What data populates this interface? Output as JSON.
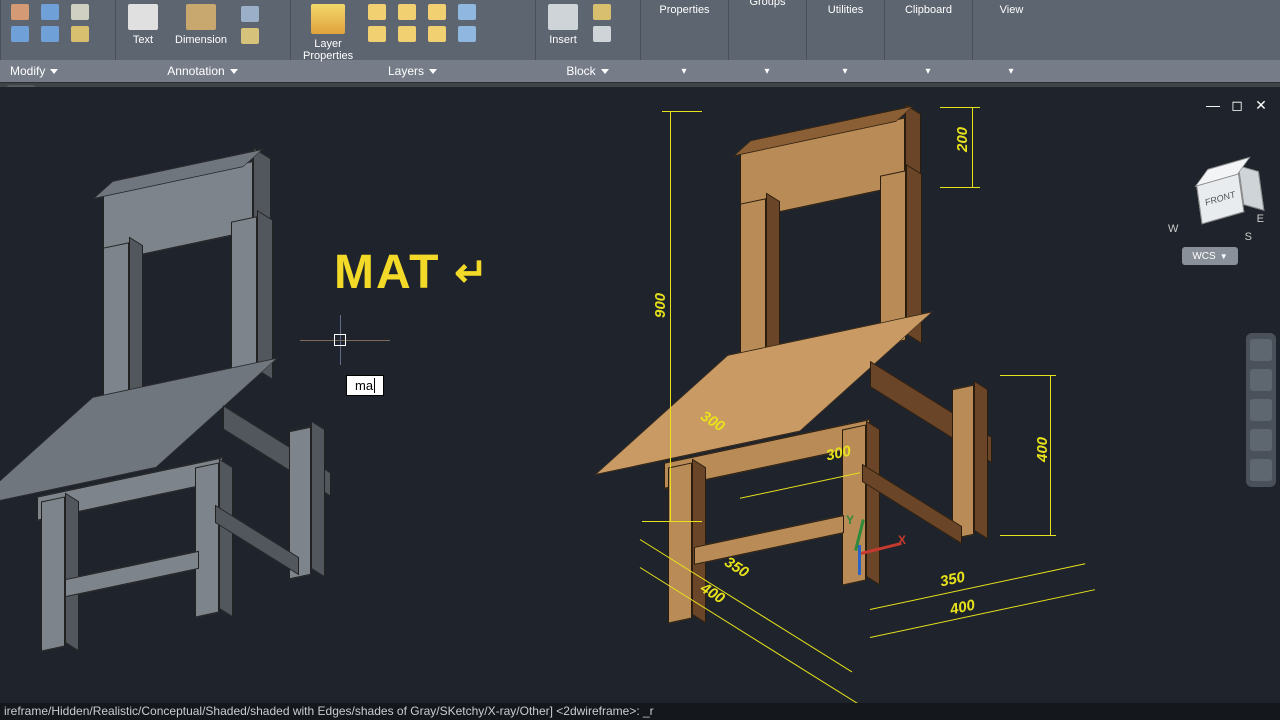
{
  "ribbon": {
    "modify_title": "Modify",
    "annotation_title": "Annotation",
    "layers_title": "Layers",
    "block_title": "Block",
    "properties_big": "Properties",
    "groups_big": "Groups",
    "utilities_big": "Utilities",
    "clipboard_big": "Clipboard",
    "view_big": "View",
    "text_label": "Text",
    "dimension_label": "Dimension",
    "layerprops_label": "Layer\nProperties",
    "insert_label": "Insert"
  },
  "overlay": {
    "text": "MAT",
    "enter": "↵"
  },
  "cmd_tip": "ma",
  "wcs": "WCS",
  "viewcube_face": "FRONT",
  "compass": {
    "w": "W",
    "s": "S",
    "e": "E"
  },
  "ucs": {
    "x": "X",
    "y": "Y"
  },
  "dims": {
    "h900": "900",
    "h200": "200",
    "w300a": "300",
    "w300b": "300",
    "h400": "400",
    "w350a": "350",
    "w350b": "350",
    "w400a": "400",
    "w400b": "400"
  },
  "cmdline": "ireframe/Hidden/Realistic/Conceptual/Shaded/shaded with Edges/shades of Gray/SKetchy/X-ray/Other] <2dwireframe>: _r"
}
